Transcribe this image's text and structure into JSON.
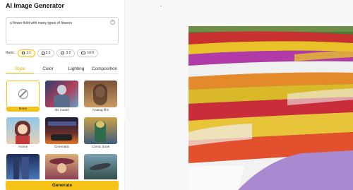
{
  "app": {
    "title": "AI Image Generator",
    "header_mark": "-"
  },
  "prompt": {
    "value": "a flower field with many types of flowers",
    "clear_icon": "clear-icon"
  },
  "ratio": {
    "label": "Ratio:",
    "options": [
      {
        "label": "1:1",
        "active": true
      },
      {
        "label": "2:3",
        "active": false
      },
      {
        "label": "3:2",
        "active": false
      },
      {
        "label": "16:9",
        "active": false
      }
    ]
  },
  "tabs": [
    {
      "label": "Style",
      "active": true
    },
    {
      "label": "Color",
      "active": false
    },
    {
      "label": "Lighting",
      "active": false
    },
    {
      "label": "Composition",
      "active": false
    }
  ],
  "styles": [
    {
      "label": "None",
      "selected": true
    },
    {
      "label": "3D model",
      "selected": false
    },
    {
      "label": "Analog film",
      "selected": false
    },
    {
      "label": "Anime",
      "selected": false
    },
    {
      "label": "Cinematic",
      "selected": false
    },
    {
      "label": "Comic book",
      "selected": false
    },
    {
      "label": "",
      "selected": false
    },
    {
      "label": "",
      "selected": false
    },
    {
      "label": "",
      "selected": false
    }
  ],
  "generate": {
    "label": "Generate"
  },
  "colors": {
    "accent": "#f6c318"
  }
}
